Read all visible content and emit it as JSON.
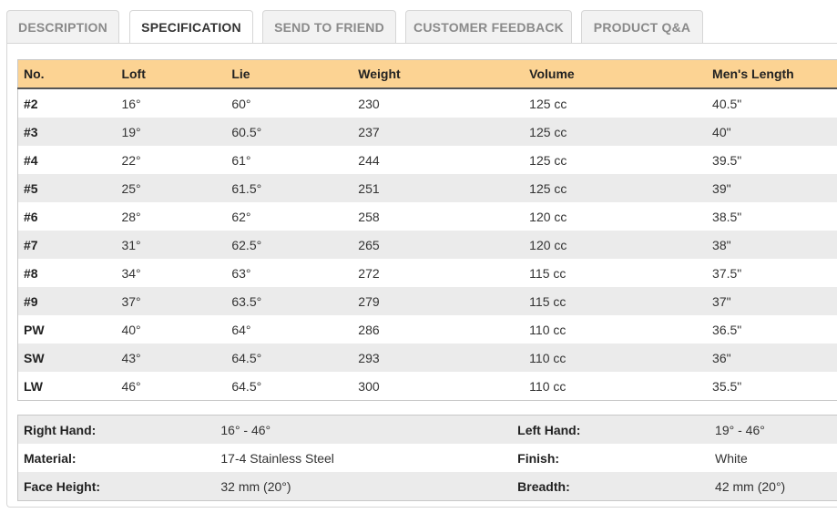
{
  "tabs": [
    {
      "label": "DESCRIPTION"
    },
    {
      "label": "SPECIFICATION"
    },
    {
      "label": "SEND TO FRIEND"
    },
    {
      "label": "CUSTOMER FEEDBACK"
    },
    {
      "label": "PRODUCT Q&A"
    }
  ],
  "active_tab": "SPECIFICATION",
  "spec_table": {
    "headers": [
      "No.",
      "Loft",
      "Lie",
      "Weight",
      "Volume",
      "Men's Length"
    ],
    "rows": [
      [
        "#2",
        "16°",
        "60°",
        "230",
        "125 cc",
        "40.5\""
      ],
      [
        "#3",
        "19°",
        "60.5°",
        "237",
        "125 cc",
        "40\""
      ],
      [
        "#4",
        "22°",
        "61°",
        "244",
        "125 cc",
        "39.5\""
      ],
      [
        "#5",
        "25°",
        "61.5°",
        "251",
        "125 cc",
        "39\""
      ],
      [
        "#6",
        "28°",
        "62°",
        "258",
        "120 cc",
        "38.5\""
      ],
      [
        "#7",
        "31°",
        "62.5°",
        "265",
        "120 cc",
        "38\""
      ],
      [
        "#8",
        "34°",
        "63°",
        "272",
        "115 cc",
        "37.5\""
      ],
      [
        "#9",
        "37°",
        "63.5°",
        "279",
        "115 cc",
        "37\""
      ],
      [
        "PW",
        "40°",
        "64°",
        "286",
        "110 cc",
        "36.5\""
      ],
      [
        "SW",
        "43°",
        "64.5°",
        "293",
        "110 cc",
        "36\""
      ],
      [
        "LW",
        "46°",
        "64.5°",
        "300",
        "110 cc",
        "35.5\""
      ]
    ]
  },
  "info_table": {
    "rows": [
      {
        "label1": "Right Hand:",
        "value1": "16° - 46°",
        "label2": "Left Hand:",
        "value2": "19° - 46°"
      },
      {
        "label1": "Material:",
        "value1": "17-4 Stainless Steel",
        "label2": "Finish:",
        "value2": "White"
      },
      {
        "label1": "Face Height:",
        "value1": "32 mm (20°)",
        "label2": "Breadth:",
        "value2": "42 mm (20°)"
      }
    ]
  }
}
